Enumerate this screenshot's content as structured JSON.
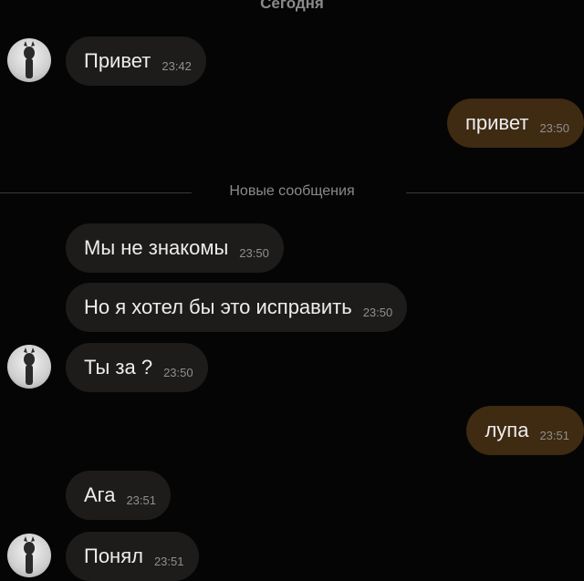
{
  "date_separator": "Сегодня",
  "unread_separator": "Новые сообщения",
  "messages": [
    {
      "text": "Привет",
      "time": "23:42",
      "direction": "incoming"
    },
    {
      "text": "привет",
      "time": "23:50",
      "direction": "outgoing"
    },
    {
      "text": "Мы не знакомы",
      "time": "23:50",
      "direction": "incoming"
    },
    {
      "text": "Но я хотел бы это исправить",
      "time": "23:50",
      "direction": "incoming"
    },
    {
      "text": "Ты за ?",
      "time": "23:50",
      "direction": "incoming"
    },
    {
      "text": "лупа",
      "time": "23:51",
      "direction": "outgoing"
    },
    {
      "text": "Ага",
      "time": "23:51",
      "direction": "incoming"
    },
    {
      "text": "Понял",
      "time": "23:51",
      "direction": "incoming"
    }
  ],
  "colors": {
    "background": "#050505",
    "incoming_bubble": "#1d1c1a",
    "outgoing_bubble": "#3f2a12",
    "message_text": "#ededed",
    "time_text": "#8f8f8f"
  },
  "icons": {
    "avatar": "user-avatar-icon"
  }
}
